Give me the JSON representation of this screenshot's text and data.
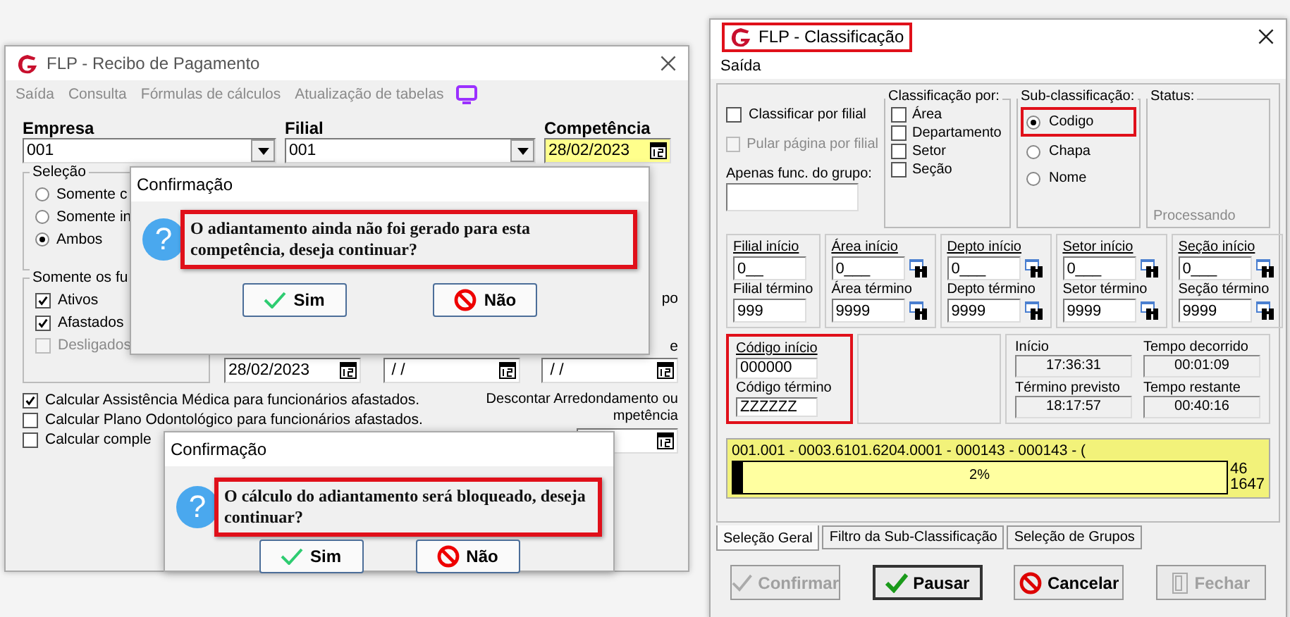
{
  "recibo_window": {
    "title": "FLP - Recibo de Pagamento",
    "menu": [
      "Saída",
      "Consulta",
      "Fórmulas de cálculos",
      "Atualização de tabelas"
    ],
    "fields": [
      {
        "label": "Empresa",
        "value": "001",
        "kind": "combo",
        "highlighted": false
      },
      {
        "label": "Filial",
        "value": "001",
        "kind": "combo",
        "highlighted": false
      },
      {
        "label": "Competência",
        "value": "28/02/2023",
        "kind": "date",
        "highlighted": true
      }
    ],
    "selecao": {
      "title": "Seleção",
      "options": [
        {
          "label": "Somente c",
          "selected": false
        },
        {
          "label": "Somente in",
          "selected": false
        },
        {
          "label": "Ambos",
          "selected": true
        }
      ]
    },
    "funcionarios": {
      "title": "Somente os fu",
      "options": [
        {
          "label": "Ativos",
          "checked": true,
          "disabled": false
        },
        {
          "label": "Afastados",
          "checked": true,
          "disabled": false
        },
        {
          "label": "Desligados",
          "checked": false,
          "disabled": true
        }
      ]
    },
    "label_fragments": [
      "po",
      "e"
    ],
    "dates": [
      "28/02/2023",
      " / /",
      " / /"
    ],
    "checks": [
      {
        "label": "Calcular Assistência Médica para funcionários afastados.",
        "checked": true
      },
      {
        "label": "Calcular Plano Odontológico para funcionários afastados.",
        "checked": false
      },
      {
        "label": "Calcular comple",
        "checked": false
      }
    ],
    "desconto": [
      "Descontar Arredondamento ou",
      "mpetência"
    ]
  },
  "dialogs": [
    {
      "title": "Confirmação",
      "icon": "?",
      "message": "O adiantamento ainda não foi gerado para esta competência, deseja continuar?",
      "highlighted": true,
      "buttons": [
        {
          "label": "Sim",
          "kind": "yes"
        },
        {
          "label": "Não",
          "kind": "no"
        }
      ]
    },
    {
      "title": "Confirmação",
      "icon": "?",
      "message": "O cálculo do adiantamento será bloqueado, deseja continuar?",
      "highlighted": true,
      "buttons": [
        {
          "label": "Sim",
          "kind": "yes"
        },
        {
          "label": "Não",
          "kind": "no"
        }
      ]
    }
  ],
  "classificacao_window": {
    "title": "FLP - Classificação",
    "title_highlighted": true,
    "menu": [
      "Saída"
    ],
    "options": [
      {
        "label": "Classificar por filial",
        "checked": false,
        "disabled": false
      },
      {
        "label": "Pular página por filial",
        "checked": false,
        "disabled": true
      }
    ],
    "grupo_label": "Apenas func. do grupo:",
    "classificacao_por": {
      "title": "Classificação  por:",
      "options": [
        {
          "label": "Área",
          "checked": false
        },
        {
          "label": "Departamento",
          "checked": false
        },
        {
          "label": "Setor",
          "checked": false
        },
        {
          "label": "Seção",
          "checked": false
        }
      ]
    },
    "sub_classificacao": {
      "title": "Sub-classificação:",
      "options": [
        {
          "label": "Codigo",
          "selected": true,
          "highlighted": true
        },
        {
          "label": "Chapa",
          "selected": false,
          "highlighted": false
        },
        {
          "label": "Nome",
          "selected": false,
          "highlighted": false
        }
      ]
    },
    "status": {
      "title": "Status:",
      "text": "Processando"
    },
    "ranges": [
      {
        "start_label": "Filial início",
        "start": "0__",
        "end_label": "Filial término",
        "end": "999",
        "lookup": false
      },
      {
        "start_label": "Área início",
        "start": "0___",
        "end_label": "Área término",
        "end": "9999",
        "lookup": true
      },
      {
        "start_label": "Depto início",
        "start": "0___",
        "end_label": "Depto término",
        "end": "9999",
        "lookup": true
      },
      {
        "start_label": "Setor início",
        "start": "0___",
        "end_label": "Setor término",
        "end": "9999",
        "lookup": true
      },
      {
        "start_label": "Seção início",
        "start": "0___",
        "end_label": "Seção término",
        "end": "9999",
        "lookup": true
      }
    ],
    "codigo": {
      "start_label": "Código início",
      "start": "000000",
      "end_label": "Código término",
      "end": "ZZZZZZ",
      "highlighted": true
    },
    "times": [
      {
        "label": "Início",
        "value": "17:36:31"
      },
      {
        "label": "Tempo decorrido",
        "value": "00:01:09"
      },
      {
        "label": "Término previsto",
        "value": "18:17:57"
      },
      {
        "label": "Tempo restante",
        "value": "00:40:16"
      }
    ],
    "progress": {
      "record": "001.001 - 0003.6101.6204.0001 - 000143 - 000143 - (",
      "level": 0.02,
      "reading": "2%",
      "count": "46",
      "total": "1647"
    },
    "tabs": [
      {
        "label": "Seleção Geral",
        "selected": true
      },
      {
        "label": "Filtro da Sub-Classificação",
        "selected": false
      },
      {
        "label": "Seleção de Grupos",
        "selected": false
      }
    ],
    "buttons": [
      {
        "label": "Confirmar",
        "kind": "confirm",
        "disabled": true
      },
      {
        "label": "Pausar",
        "kind": "pause",
        "disabled": false
      },
      {
        "label": "Cancelar",
        "kind": "cancel",
        "disabled": false
      },
      {
        "label": "Fechar",
        "kind": "close",
        "disabled": true
      }
    ]
  }
}
